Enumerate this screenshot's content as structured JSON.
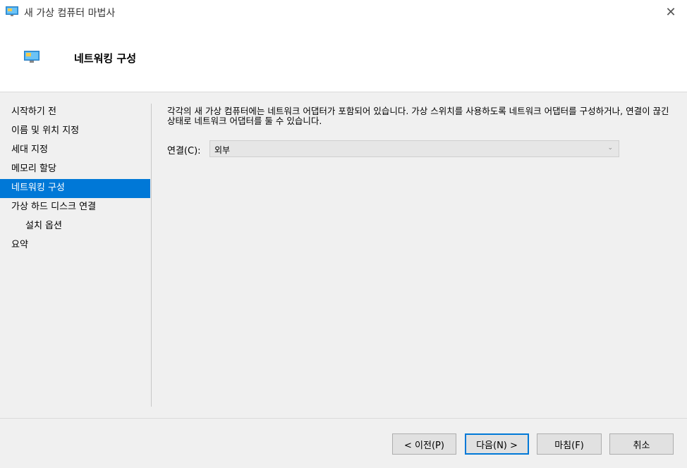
{
  "window": {
    "title": "새 가상 컴퓨터 마법사",
    "close_glyph": "✕",
    "app_icon": "monitor-icon"
  },
  "header": {
    "title": "네트워킹 구성",
    "icon": "monitor-icon"
  },
  "nav": {
    "items": [
      {
        "label": "시작하기 전"
      },
      {
        "label": "이름 및 위치 지정"
      },
      {
        "label": "세대 지정"
      },
      {
        "label": "메모리 할당"
      },
      {
        "label": "네트워킹 구성"
      },
      {
        "label": "가상 하드 디스크 연결"
      },
      {
        "label": "설치 옵션"
      },
      {
        "label": "요약"
      }
    ],
    "active_index": 4
  },
  "content": {
    "description": "각각의 새 가상 컴퓨터에는 네트워크 어댑터가 포함되어 있습니다. 가상 스위치를 사용하도록 네트워크 어댑터를 구성하거나, 연결이 끊긴 상태로 네트워크 어댑터를 둘 수 있습니다.",
    "connection_label": "연결(C):",
    "connection_value": "외부",
    "chevron_glyph": "⌄"
  },
  "footer": {
    "prev_label": "< 이전(P)",
    "next_label": "다음(N) >",
    "finish_label": "마침(F)",
    "cancel_label": "취소"
  },
  "colors": {
    "accent": "#0078d7",
    "panel_bg": "#f0f0f0"
  }
}
